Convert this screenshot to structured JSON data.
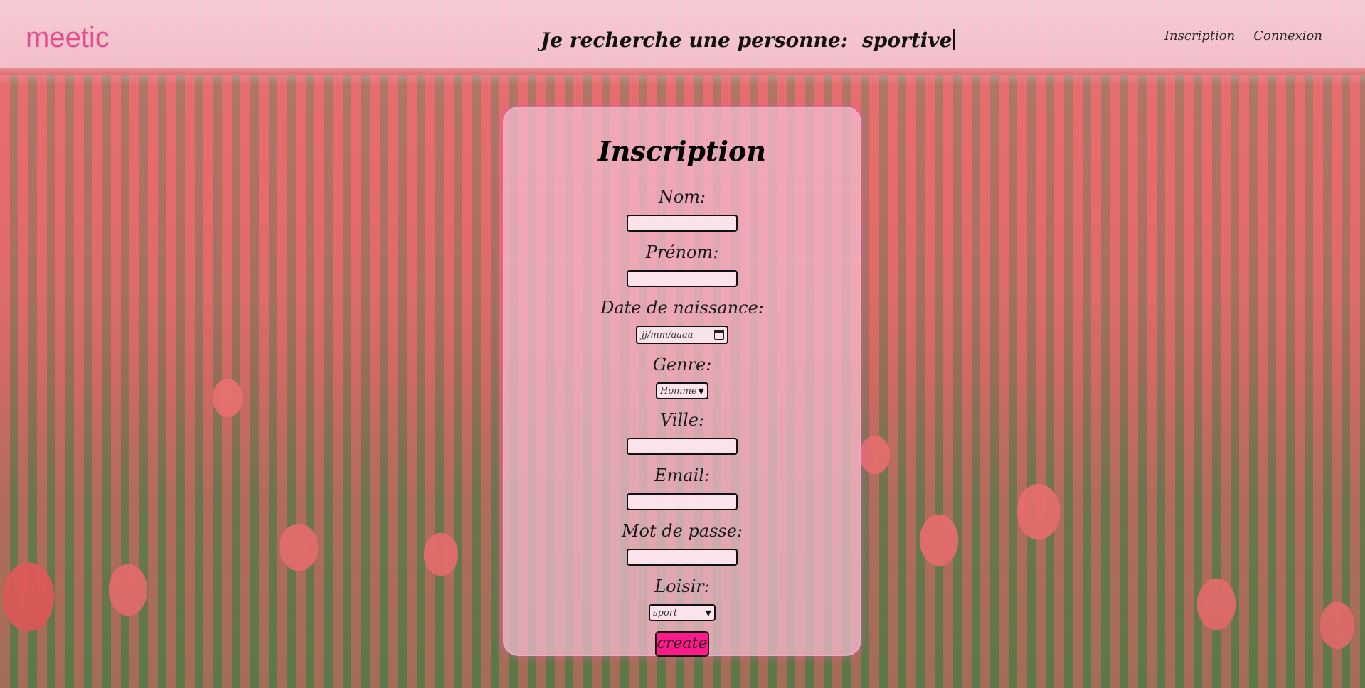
{
  "header": {
    "logo_text": "meetic",
    "search_prefix": "Je recherche une personne:",
    "search_value": "sportive",
    "nav": {
      "inscription": "Inscription",
      "connexion": "Connexion"
    }
  },
  "form": {
    "title": "Inscription",
    "nom_label": "Nom:",
    "nom_value": "",
    "prenom_label": "Prénom:",
    "prenom_value": "",
    "date_label": "Date de naissance:",
    "date_placeholder": "jj/mm/aaaa",
    "genre_label": "Genre:",
    "genre_value": "Homme",
    "ville_label": "Ville:",
    "ville_value": "",
    "email_label": "Email:",
    "email_value": "",
    "password_label": "Mot de passe:",
    "password_value": "",
    "loisir_label": "Loisir:",
    "loisir_value": "sport",
    "submit_label": "create"
  },
  "icons": {
    "calendar": "calendar-icon",
    "dropdown": "chevron-down-icon"
  },
  "colors": {
    "logo": "#e24f8f",
    "card_background": "#f5bed2",
    "button": "#ff1a8c",
    "header_background": "#f8cdd6"
  }
}
